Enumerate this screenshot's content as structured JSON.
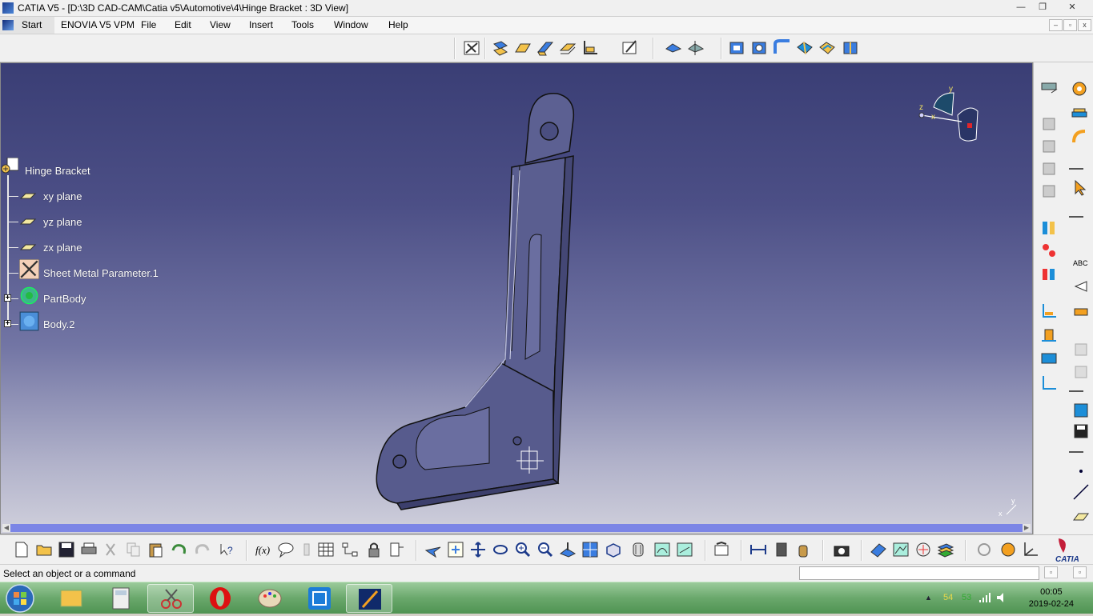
{
  "window": {
    "title": "CATIA V5 - [D:\\3D CAD-CAM\\Catia v5\\Automotive\\4\\Hinge Bracket : 3D View]",
    "minimize": "—",
    "maximize": "❐",
    "close": "✕"
  },
  "menu": {
    "start": "Start",
    "items": [
      "ENOVIA V5 VPM",
      "File",
      "Edit",
      "View",
      "Insert",
      "Tools",
      "Window",
      "Help"
    ]
  },
  "tree": {
    "root": "Hinge Bracket",
    "nodes": [
      "xy plane",
      "yz plane",
      "zx plane",
      "Sheet Metal Parameter.1",
      "PartBody",
      "Body.2"
    ]
  },
  "compass": {
    "x": "x",
    "y": "y",
    "z": "z"
  },
  "mini_axis": {
    "x": "x",
    "y": "y"
  },
  "status": {
    "message": "Select an object or a command",
    "command_input": ""
  },
  "taskbar": {
    "time": "00:05",
    "date": "2019-02-24",
    "tray_numbers": [
      "54",
      "53"
    ]
  },
  "colors": {
    "viewport_top": "#3a3e75",
    "viewport_bottom": "#d0d0dc",
    "scrollbar": "#7b85e6",
    "taskbar": "#6aa86c"
  },
  "icons": {
    "app": "catia-logo-icon",
    "brand": "catia-3ds-logo-icon"
  }
}
